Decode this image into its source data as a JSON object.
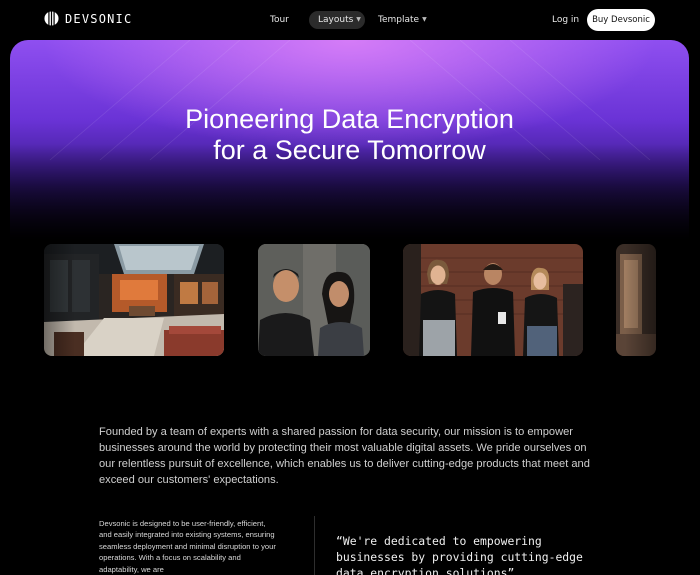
{
  "nav": {
    "brand": "DEVSONIC",
    "items": [
      {
        "label": "Tour"
      },
      {
        "label": "Layouts",
        "icon": "caret-down-icon"
      },
      {
        "label": "Template",
        "icon": "caret-down-icon"
      }
    ],
    "login": "Log in",
    "cta": "Buy Devsonic"
  },
  "hero": {
    "title_line1": "Pioneering Data Encryption",
    "title_line2": "for a Secure Tomorrow",
    "gradient_colors": [
      "#d57cf7",
      "#8f4ff0",
      "#3a1a8c",
      "#000000"
    ]
  },
  "gallery": [
    {
      "icon": "office-lounge-photo"
    },
    {
      "icon": "team-duo-photo"
    },
    {
      "icon": "team-trio-photo"
    },
    {
      "icon": "office-interior-photo"
    }
  ],
  "about": {
    "text": "Founded by a team of experts with a shared passion for data security, our mission is to empower businesses around the world by protecting their most valuable digital assets. We pride ourselves on our relentless pursuit of excellence, which enables us to deliver cutting-edge products that meet and exceed our customers' expectations."
  },
  "feature": {
    "text": "Devsonic is designed to be user-friendly, efficient, and easily integrated into existing systems, ensuring seamless deployment and minimal disruption to your operations. With a focus on scalability and adaptability, we are"
  },
  "quote": {
    "text": "“We're dedicated to empowering businesses by providing cutting-edge data encryption solutions”"
  }
}
